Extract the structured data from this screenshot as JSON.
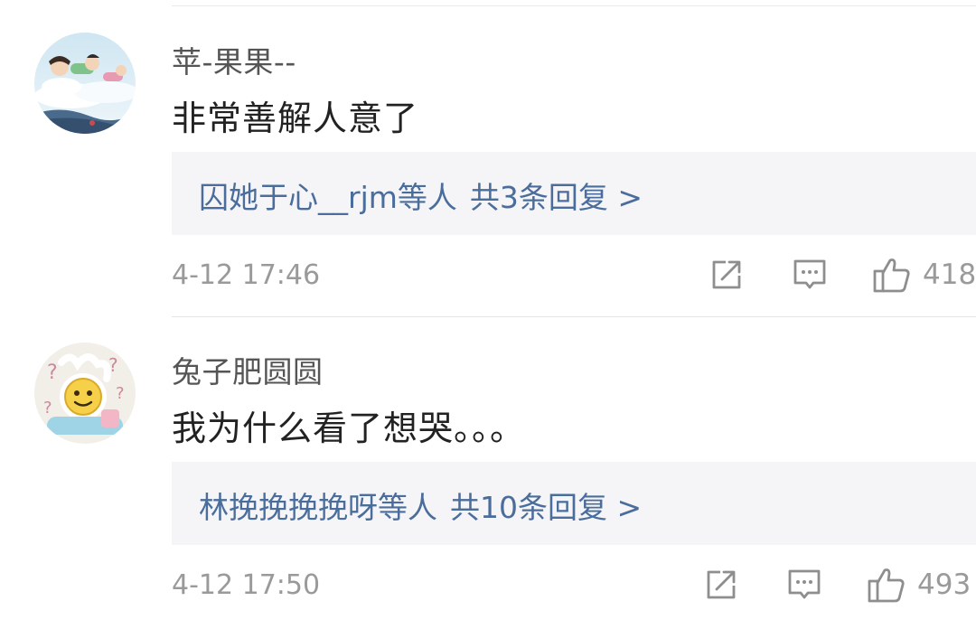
{
  "comments": [
    {
      "username": "苹-果果--",
      "text": "非常善解人意了",
      "reply": {
        "users": "囚她于心__rjm等人",
        "count_label": "共3条回复 >"
      },
      "time": "4-12 17:46",
      "likes": "418",
      "avatar_icon": "anime-clouds-avatar"
    },
    {
      "username": "兔子肥圆圆",
      "text": "我为什么看了想哭。。。",
      "reply": {
        "users": "林挽挽挽挽呀等人",
        "count_label": "共10条回复 >"
      },
      "time": "4-12 17:50",
      "likes": "493",
      "avatar_icon": "smiley-question-avatar"
    }
  ],
  "icons": {
    "share": "share-icon",
    "comment": "comment-icon",
    "like": "thumbs-up-icon"
  },
  "colors": {
    "link": "#4a6d9c",
    "reply_bg": "#f5f5f7",
    "meta": "#9a9a9a"
  }
}
